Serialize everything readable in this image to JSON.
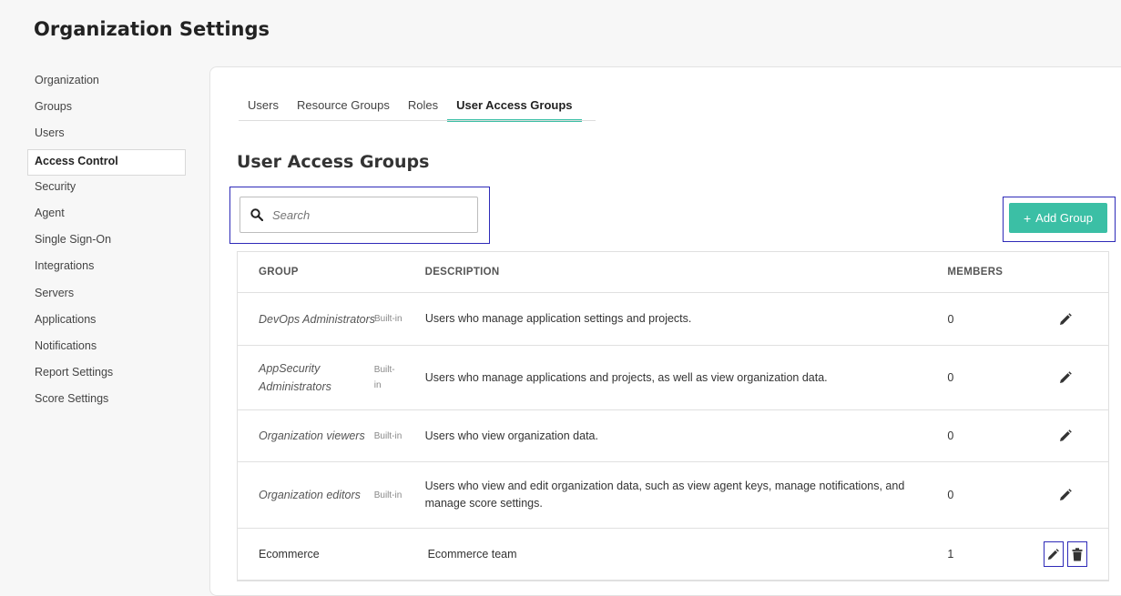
{
  "page": {
    "title": "Organization Settings"
  },
  "sidebar": {
    "items": [
      {
        "label": "Organization"
      },
      {
        "label": "Groups"
      },
      {
        "label": "Users"
      },
      {
        "label": "Access Control"
      },
      {
        "label": "Security"
      },
      {
        "label": "Agent"
      },
      {
        "label": "Single Sign-On"
      },
      {
        "label": "Integrations"
      },
      {
        "label": "Servers"
      },
      {
        "label": "Applications"
      },
      {
        "label": "Notifications"
      },
      {
        "label": "Report Settings"
      },
      {
        "label": "Score Settings"
      }
    ],
    "active_index": 3
  },
  "tabs": [
    {
      "label": "Users"
    },
    {
      "label": "Resource Groups"
    },
    {
      "label": "Roles"
    },
    {
      "label": "User Access Groups"
    }
  ],
  "active_tab_index": 3,
  "section": {
    "title": "User Access Groups"
  },
  "search": {
    "placeholder": "Search",
    "value": ""
  },
  "add_button": {
    "label": "Add Group",
    "icon": "plus-icon"
  },
  "accent_color": "#3bbfa5",
  "table": {
    "headers": {
      "group": "GROUP",
      "description": "DESCRIPTION",
      "members": "MEMBERS"
    },
    "rows": [
      {
        "group": "DevOps Administrators",
        "badge": "Built-in",
        "description": "Users who manage application settings and projects.",
        "members": "0"
      },
      {
        "group": "AppSecurity Administrators",
        "badge": "Built-in",
        "description": "Users who manage applications and projects, as well as view organization data.",
        "members": "0"
      },
      {
        "group": "Organization viewers",
        "badge": "Built-in",
        "description": "Users who view organization data.",
        "members": "0"
      },
      {
        "group": "Organization editors",
        "badge": "Built-in",
        "description": "Users who view and edit organization data, such as view agent keys, manage notifications, and manage score settings.",
        "members": "0"
      },
      {
        "group": "Ecommerce",
        "badge": "",
        "description": "Ecommerce team",
        "members": "1"
      }
    ]
  }
}
